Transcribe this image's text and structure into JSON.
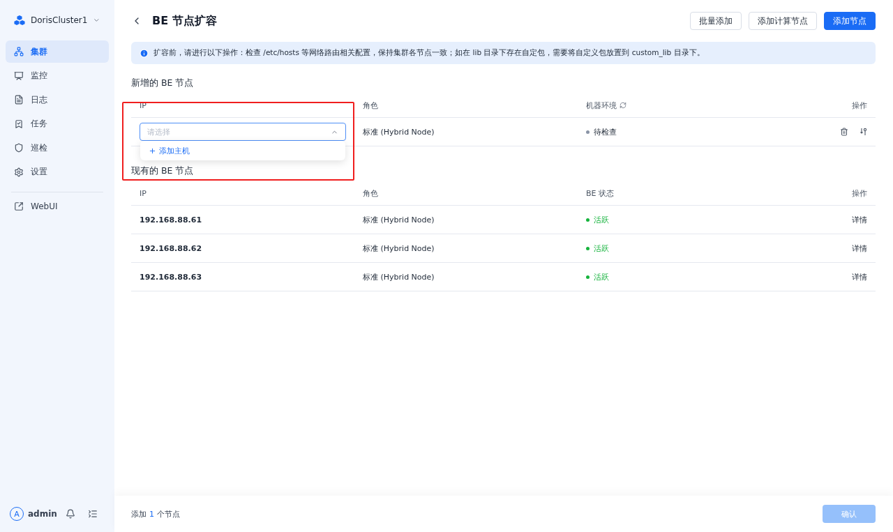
{
  "sidebar": {
    "cluster": "DorisCluster1",
    "items": [
      {
        "label": "集群",
        "selected": true
      },
      {
        "label": "监控",
        "selected": false
      },
      {
        "label": "日志",
        "selected": false
      },
      {
        "label": "任务",
        "selected": false
      },
      {
        "label": "巡检",
        "selected": false
      },
      {
        "label": "设置",
        "selected": false
      }
    ],
    "links": [
      {
        "label": "WebUI"
      }
    ],
    "user": {
      "avatar": "A",
      "name": "admin"
    }
  },
  "header": {
    "title": "BE 节点扩容",
    "buttons": [
      {
        "label": "批量添加",
        "kind": "default"
      },
      {
        "label": "添加计算节点",
        "kind": "default"
      },
      {
        "label": "添加节点",
        "kind": "primary"
      }
    ]
  },
  "alert": "扩容前，请进行以下操作：检查 /etc/hosts 等网络路由相关配置，保持集群各节点一致；如在 lib 目录下存在自定包，需要将自定义包放置到 custom_lib 目录下。",
  "new_nodes": {
    "title": "新增的 BE 节点",
    "columns": [
      "IP",
      "角色",
      "机器环境",
      "操作"
    ],
    "rows": [
      {
        "ip": {
          "placeholder": "请选择",
          "expanded": true,
          "options": [
            "添加主机"
          ]
        },
        "role": "标准 (Hybrid Node)",
        "status": {
          "text": "待检查",
          "color": "#8a94a6"
        }
      }
    ]
  },
  "existing_nodes": {
    "title": "现有的 BE 节点",
    "columns": [
      "IP",
      "角色",
      "BE 状态",
      "操作"
    ],
    "rows": [
      {
        "ip": "192.168.88.61",
        "role": "标准 (Hybrid Node)",
        "status": {
          "text": "活跃",
          "color": "#16b33d"
        },
        "action": "详情"
      },
      {
        "ip": "192.168.88.62",
        "role": "标准 (Hybrid Node)",
        "status": {
          "text": "活跃",
          "color": "#16b33d"
        },
        "action": "详情"
      },
      {
        "ip": "192.168.88.63",
        "role": "标准 (Hybrid Node)",
        "status": {
          "text": "活跃",
          "color": "#16b33d"
        },
        "action": "详情"
      }
    ]
  },
  "footer": {
    "prefix": "添加",
    "count": "1",
    "suffix": "个节点",
    "confirm": {
      "label": "确认",
      "disabled": true
    }
  }
}
